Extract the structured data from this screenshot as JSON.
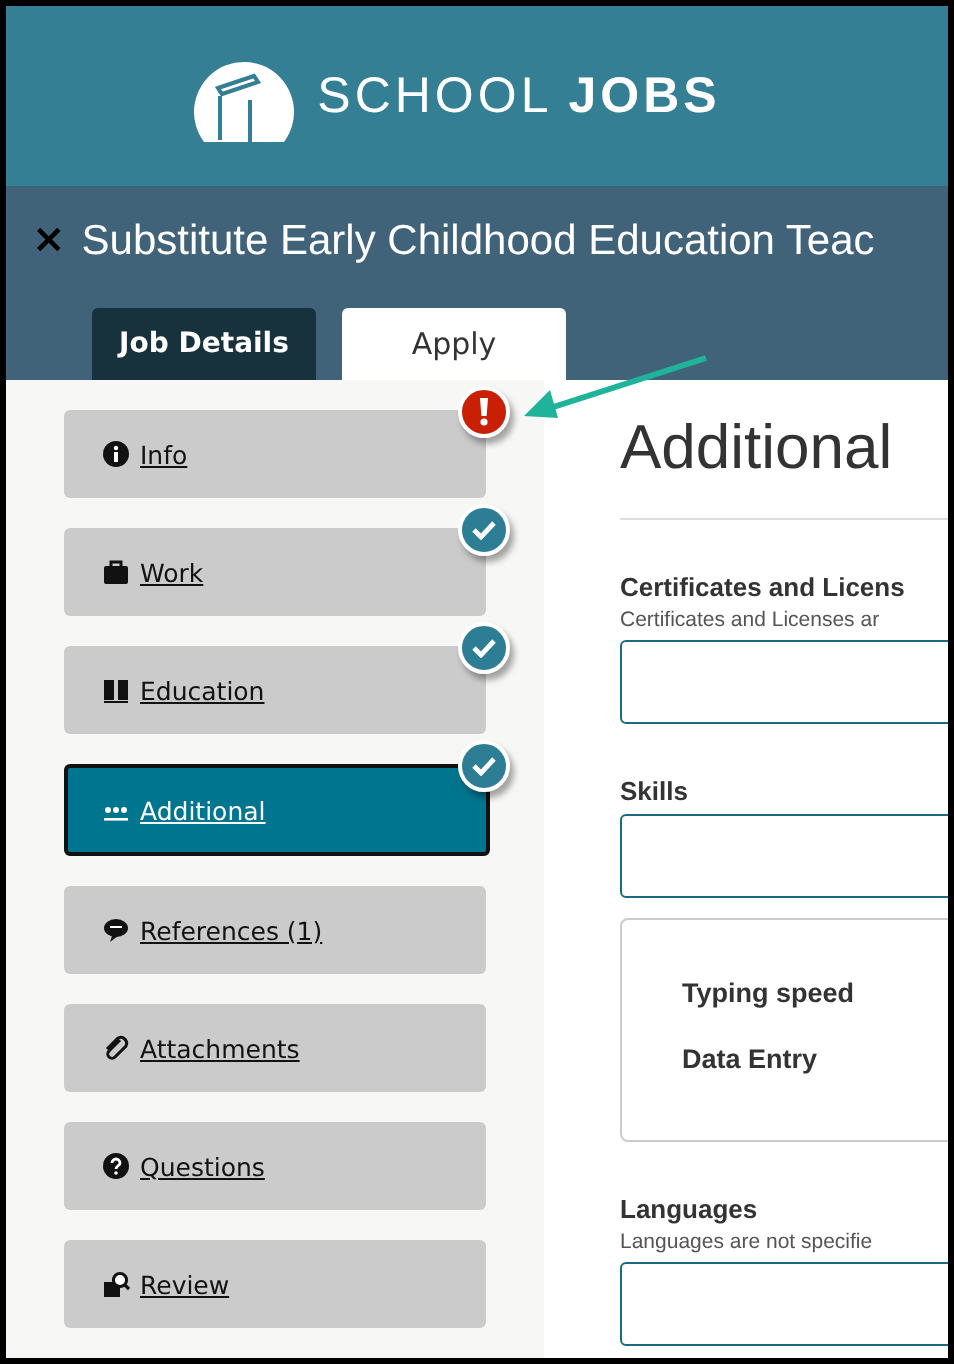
{
  "logo": "SCHOOL **JOBS**",
  "job_title": "Substitute Early Childhood Education Teac",
  "close": "×",
  "tabs": [
    {
      "label": "Job Details",
      "selected": false
    },
    {
      "label": "Apply",
      "selected": true
    }
  ],
  "steps": [
    {
      "label": "Info",
      "error": true,
      "complete": false,
      "selected": false
    },
    {
      "label": "Work",
      "error": false,
      "complete": true,
      "selected": false
    },
    {
      "label": "Education",
      "error": false,
      "complete": true,
      "selected": false
    },
    {
      "label": "Additional",
      "error": false,
      "complete": true,
      "selected": true
    },
    {
      "label": "References (1)",
      "error": false,
      "complete": false,
      "selected": false
    },
    {
      "label": "Attachments",
      "error": false,
      "complete": false,
      "selected": false
    },
    {
      "label": "Questions",
      "error": false,
      "complete": false,
      "selected": false
    },
    {
      "label": "Review",
      "error": false,
      "complete": false,
      "selected": false
    }
  ],
  "heading": "Additional",
  "sections": [
    {
      "kind": "field",
      "label": "Certificates and Licens",
      "note": "Certificates and Licenses ar"
    },
    {
      "kind": "field",
      "label": "Skills"
    },
    {
      "kind": "list",
      "items": [
        "Typing speed",
        "Data Entry"
      ]
    },
    {
      "kind": "field",
      "label": "Languages",
      "note": "Languages are not specifie"
    }
  ]
}
